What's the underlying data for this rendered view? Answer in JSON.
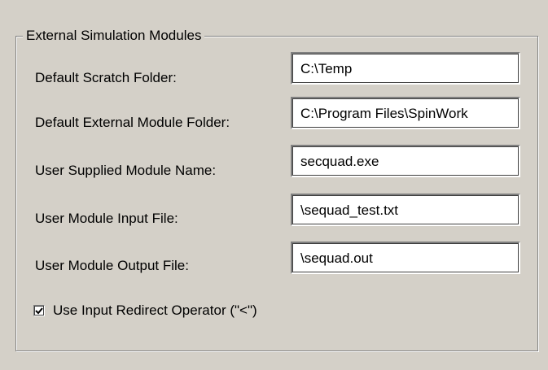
{
  "group": {
    "title": "External Simulation Modules"
  },
  "fields": [
    {
      "label": "Default Scratch Folder:",
      "value": "C:\\Temp"
    },
    {
      "label": "Default External Module Folder:",
      "value": "C:\\Program Files\\SpinWork"
    },
    {
      "label": "User Supplied Module Name:",
      "value": "secquad.exe"
    },
    {
      "label": "User Module Input File:",
      "value": "\\sequad_test.txt"
    },
    {
      "label": "User Module Output File:",
      "value": "\\sequad.out"
    }
  ],
  "redirect_option": {
    "label": "Use Input Redirect Operator (\"<\")",
    "checked": true
  }
}
